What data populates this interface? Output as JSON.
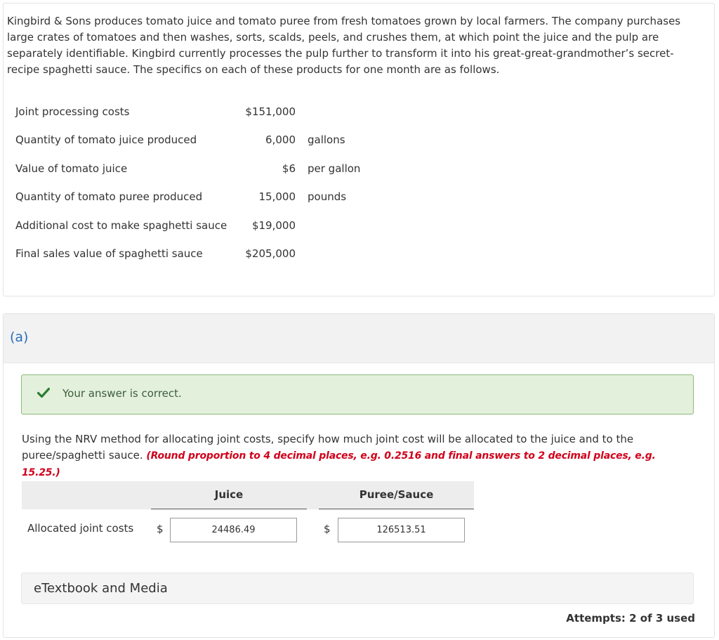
{
  "intro": "Kingbird & Sons produces tomato juice and tomato puree from fresh tomatoes grown by local farmers. The company purchases large crates of tomatoes and then washes, sorts, scalds, peels, and crushes them, at which point the juice and the pulp are separately identifiable. Kingbird currently processes the pulp further to transform it into his great-great-grandmother’s secret-recipe spaghetti sauce. The specifics on each of these products for one month are as follows.",
  "specs": [
    {
      "label": "Joint processing costs",
      "value": "$151,000",
      "unit": ""
    },
    {
      "label": "Quantity of tomato juice produced",
      "value": "6,000",
      "unit": "gallons"
    },
    {
      "label": "Value of tomato juice",
      "value": "$6",
      "unit": "per gallon"
    },
    {
      "label": "Quantity of tomato puree produced",
      "value": "15,000",
      "unit": "pounds"
    },
    {
      "label": "Additional cost to make spaghetti sauce",
      "value": "$19,000",
      "unit": ""
    },
    {
      "label": "Final sales value of spaghetti sauce",
      "value": "$205,000",
      "unit": ""
    }
  ],
  "part": {
    "label": "(a)",
    "feedback": "Your answer is correct.",
    "question": "Using the NRV method for allocating joint costs, specify how much joint cost will be allocated to the juice and to the puree/spaghetti sauce.",
    "instruction": "(Round proportion to 4 decimal places, e.g. 0.2516 and final answers to 2 decimal places, e.g. 15.25.)",
    "columns": [
      "Juice",
      "Puree/Sauce"
    ],
    "row_label": "Allocated joint costs",
    "currency": "$",
    "answers": {
      "juice": "24486.49",
      "puree": "126513.51"
    },
    "etextbook": "eTextbook and Media",
    "attempts": "Attempts: 2 of 3 used"
  },
  "colors": {
    "accent": "#2a6ebb",
    "success_bg": "#e3f1dc",
    "success_border": "#8bb97a",
    "check": "#2e7d32",
    "instruction": "#d0021b"
  }
}
